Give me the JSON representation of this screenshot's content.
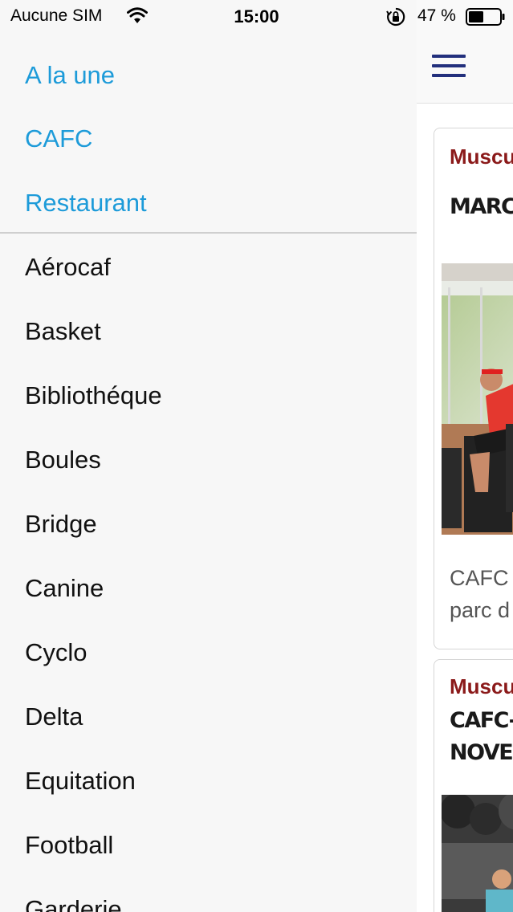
{
  "status_bar": {
    "carrier": "Aucune SIM",
    "time": "15:00",
    "battery_percent": "47 %",
    "icons": [
      "wifi-icon",
      "orientation-lock-icon",
      "battery-icon"
    ]
  },
  "side_menu": {
    "top_items": [
      {
        "label": "A la une"
      },
      {
        "label": "CAFC"
      },
      {
        "label": "Restaurant"
      }
    ],
    "items": [
      {
        "label": "Aérocaf"
      },
      {
        "label": "Basket"
      },
      {
        "label": "Bibliothéque"
      },
      {
        "label": "Boules"
      },
      {
        "label": "Bridge"
      },
      {
        "label": "Canine"
      },
      {
        "label": "Cyclo"
      },
      {
        "label": "Delta"
      },
      {
        "label": "Equitation"
      },
      {
        "label": "Football"
      },
      {
        "label": "Garderie"
      }
    ],
    "accent_color": "#1d9bd9"
  },
  "main": {
    "header": {
      "menu_icon": "hamburger-icon"
    },
    "cards": [
      {
        "category": "Muscu",
        "title_lines": [
          "MARCHE"
        ],
        "excerpt_lines": [
          "CAFC",
          "parc d"
        ]
      },
      {
        "category": "Muscu",
        "title_lines": [
          "CAFC-TH",
          "NOVEMB"
        ]
      }
    ],
    "category_color": "#8b1a1a"
  }
}
